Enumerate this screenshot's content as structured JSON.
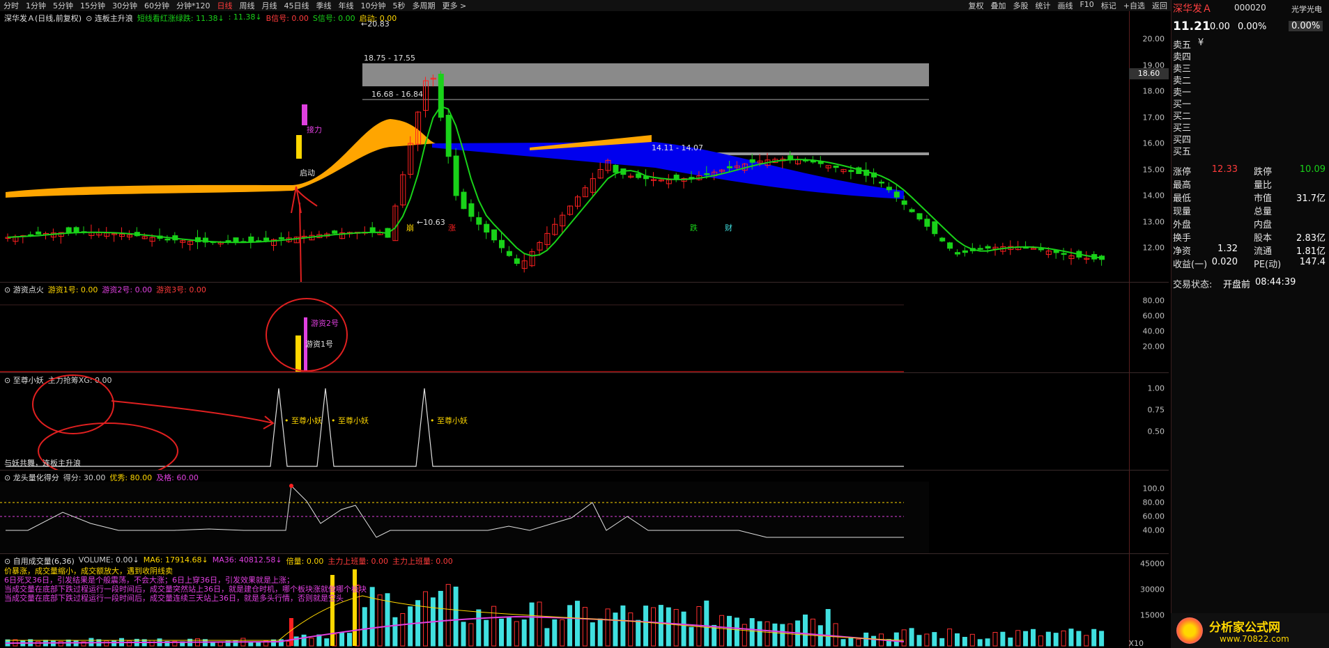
{
  "toolbar": {
    "periods": [
      "分时",
      "1分钟",
      "5分钟",
      "15分钟",
      "30分钟",
      "60分钟",
      "分钟*120",
      "日线",
      "周线",
      "月线",
      "45日线",
      "季线",
      "年线",
      "10分钟",
      "5秒",
      "多周期",
      "更多 >"
    ],
    "active_period": "日线",
    "right": [
      "复权",
      "叠加",
      "多股",
      "统计",
      "画线",
      "F10",
      "标记",
      "+自选",
      "返回"
    ]
  },
  "main_panel": {
    "title": "深华发Ａ(日线,前复权)",
    "indicator_name": "连板主升浪",
    "legend": [
      {
        "text": "短线看红涨绿跌: 11.38↓",
        "color": "#19d219"
      },
      {
        "text": ": 11.38↓",
        "color": "#19d219"
      },
      {
        "text": "B信号: 0.00",
        "color": "#ff3b3b"
      },
      {
        "text": "S信号: 0.00",
        "color": "#19d219"
      },
      {
        "text": "启动: 0.00",
        "color": "#ffd700"
      }
    ],
    "yticks": [
      "20.00",
      "19.00",
      "18.00",
      "17.00",
      "16.00",
      "15.00",
      "14.00",
      "13.00",
      "12.00"
    ],
    "price_marker": "18.60",
    "annotations": {
      "high": "20.83",
      "low": "10.63",
      "band1": "18.75 - 17.55",
      "band2": "16.68 - 16.84",
      "band3": "14.11 - 14.07"
    },
    "labels": {
      "jieli": "接力",
      "qidong": "启动",
      "beng": "崩",
      "zhang": "涨",
      "die": "跌",
      "cai": "财"
    }
  },
  "panel_youzi": {
    "title": "游资点火",
    "legend": [
      {
        "text": "游资1号: 0.00",
        "color": "#ffd700"
      },
      {
        "text": "游资2号: 0.00",
        "color": "#e040e0"
      },
      {
        "text": "游资3号: 0.00",
        "color": "#ff3b3b"
      }
    ],
    "yticks": [
      "80.00",
      "60.00",
      "40.00",
      "20.00"
    ],
    "bar_labels": [
      "游资2号",
      "游资1号"
    ]
  },
  "panel_zhizun": {
    "title": "至尊小妖",
    "legend": [
      {
        "text": "主力抢筹XG: 0.00",
        "color": "#d0d0d0"
      }
    ],
    "yticks": [
      "1.00",
      "0.75",
      "0.50"
    ],
    "spike_label": "至尊小妖",
    "footer": "与妖共舞，连板主升浪"
  },
  "panel_longtou": {
    "title": "龙头量化得分",
    "legend": [
      {
        "text": "得分: 30.00",
        "color": "#d0d0d0"
      },
      {
        "text": "优秀: 80.00",
        "color": "#ffd700"
      },
      {
        "text": "及格: 60.00",
        "color": "#e040e0"
      }
    ],
    "yticks": [
      "100.0",
      "80.00",
      "60.00",
      "40.00"
    ]
  },
  "panel_volume": {
    "title": "自用成交量(6,36)",
    "legend": [
      {
        "text": "VOLUME: 0.00↓",
        "color": "#d0d0d0"
      },
      {
        "text": "MA6: 17914.68↓",
        "color": "#ffd700"
      },
      {
        "text": "MA36: 40812.58↓",
        "color": "#e040e0"
      },
      {
        "text": "倍量: 0.00",
        "color": "#ffd700"
      },
      {
        "text": "主力上班量: 0.00",
        "color": "#ff3b3b"
      },
      {
        "text": "主力上班量: 0.00",
        "color": "#ff3b3b"
      }
    ],
    "yticks": [
      "45000",
      "30000",
      "15000"
    ],
    "unit": "X10",
    "notes": [
      {
        "text": "价暴涨，成交量缩小，成交额放大，遇到收阴线卖",
        "color": "#ffd700"
      },
      {
        "text": "6日死叉36日，引发结果是个般震荡，不会大涨；6日上穿36日，引发效果就是上涨；",
        "color": "#e040e0"
      },
      {
        "text": "当成交量在底部下跌过程运行一段时间后，成交量突然站上36日，就是建仓时机，哪个板块涨就做哪个板块",
        "color": "#e040e0"
      },
      {
        "text": "当成交量在底部下跌过程运行一段时间后，成交量连续三天站上36日，就是多头行情，否则就是空头",
        "color": "#e040e0"
      }
    ]
  },
  "quote": {
    "name": "深华发Ａ",
    "code": "000020",
    "tag": "光学光电",
    "price": "11.21",
    "change": "0.00",
    "change_pct": "0.00%",
    "pct_box": "0.00%",
    "asks": [
      "卖五",
      "卖四",
      "卖三",
      "卖二",
      "卖一"
    ],
    "bids": [
      "买一",
      "买二",
      "买三",
      "买四",
      "买五"
    ],
    "yen": "¥",
    "stats": [
      {
        "l": "涨停",
        "lv": "12.33",
        "lc": "#ff3b3b",
        "r": "跌停",
        "rv": "10.09",
        "rc": "#19d219"
      },
      {
        "l": "最高",
        "lv": "",
        "lc": "#fff",
        "r": "量比",
        "rv": "",
        "rc": "#fff"
      },
      {
        "l": "最低",
        "lv": "",
        "lc": "#fff",
        "r": "市值",
        "rv": "31.7亿",
        "rc": "#fff"
      },
      {
        "l": "现量",
        "lv": "",
        "lc": "#fff",
        "r": "总量",
        "rv": "",
        "rc": "#fff"
      },
      {
        "l": "外盘",
        "lv": "",
        "lc": "#fff",
        "r": "内盘",
        "rv": "",
        "rc": "#fff"
      },
      {
        "l": "换手",
        "lv": "",
        "lc": "#fff",
        "r": "股本",
        "rv": "2.83亿",
        "rc": "#fff"
      },
      {
        "l": "净资",
        "lv": "1.32",
        "lc": "#fff",
        "r": "流通",
        "rv": "1.81亿",
        "rc": "#fff"
      },
      {
        "l": "收益(一)",
        "lv": "0.020",
        "lc": "#fff",
        "r": "PE(动)",
        "rv": "147.4",
        "rc": "#fff"
      }
    ],
    "status_label": "交易状态:",
    "status_value": "开盘前",
    "status_time": "08:44:39"
  },
  "logo": {
    "title": "分析家公式网",
    "url": "www.70822.com"
  },
  "colors": {
    "up": "#ff2020",
    "down": "#19d219",
    "cyan": "#40e0e0",
    "yellow": "#ffd700",
    "magenta": "#e040e0",
    "blue": "#0000ee",
    "orange": "#ffa500"
  }
}
